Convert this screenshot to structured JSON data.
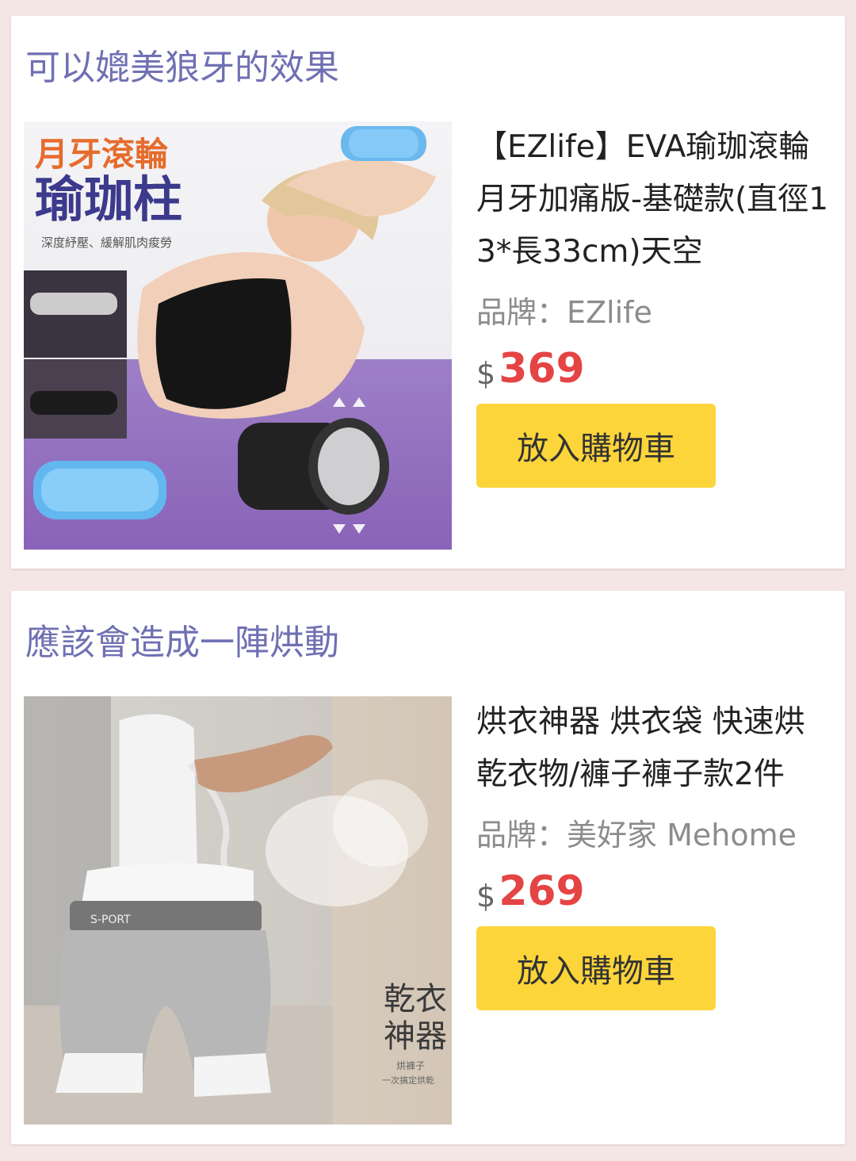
{
  "products": [
    {
      "heading": "可以媲美狼牙的效果",
      "name": "【EZlife】EVA瑜珈滾輪月牙加痛版-基礎款(直徑13*長33cm)天空",
      "brand": "品牌：EZlife",
      "currency": "$",
      "price": "369",
      "button_label": "放入購物車",
      "image_text": {
        "title_line1": "月牙滾輪",
        "title_line2": "瑜珈柱",
        "subtitle": "深度紓壓、緩解肌肉痠勞"
      }
    },
    {
      "heading": "應該會造成一陣烘動",
      "name": "烘衣神器 烘衣袋 快速烘乾衣物/褲子褲子款2件",
      "brand": "品牌：美好家 Mehome",
      "currency": "$",
      "price": "269",
      "button_label": "放入購物車",
      "image_text": {
        "waistband": "S-PORT",
        "title_line1": "乾衣",
        "title_line2": "神器",
        "subtitle1": "烘褲子",
        "subtitle2": "一次搞定烘乾"
      }
    }
  ],
  "colors": {
    "page_background": "#f5e6e6",
    "heading": "#6f70b3",
    "price": "#e54444",
    "button": "#fcd53a"
  }
}
